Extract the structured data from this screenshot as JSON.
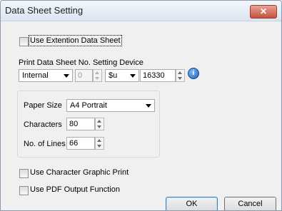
{
  "window": {
    "title": "Data Sheet Setting",
    "close_symbol": "✕"
  },
  "use_extension": {
    "label": "Use Extention Data Sheet",
    "checked": false
  },
  "device": {
    "label": "Print Data Sheet No. Setting Device",
    "mode": "Internal",
    "station": "0",
    "device_type": "$u",
    "address": "16330",
    "info_glyph": "i"
  },
  "paper": {
    "size_label": "Paper Size",
    "size_value": "A4 Portrait",
    "chars_label": "Characters",
    "chars_value": "80",
    "lines_label": "No. of Lines",
    "lines_value": "66"
  },
  "char_graphic": {
    "label": "Use Character Graphic Print",
    "checked": false
  },
  "pdf_output": {
    "label": "Use PDF Output Function",
    "checked": false
  },
  "buttons": {
    "ok": "OK",
    "cancel": "Cancel"
  }
}
